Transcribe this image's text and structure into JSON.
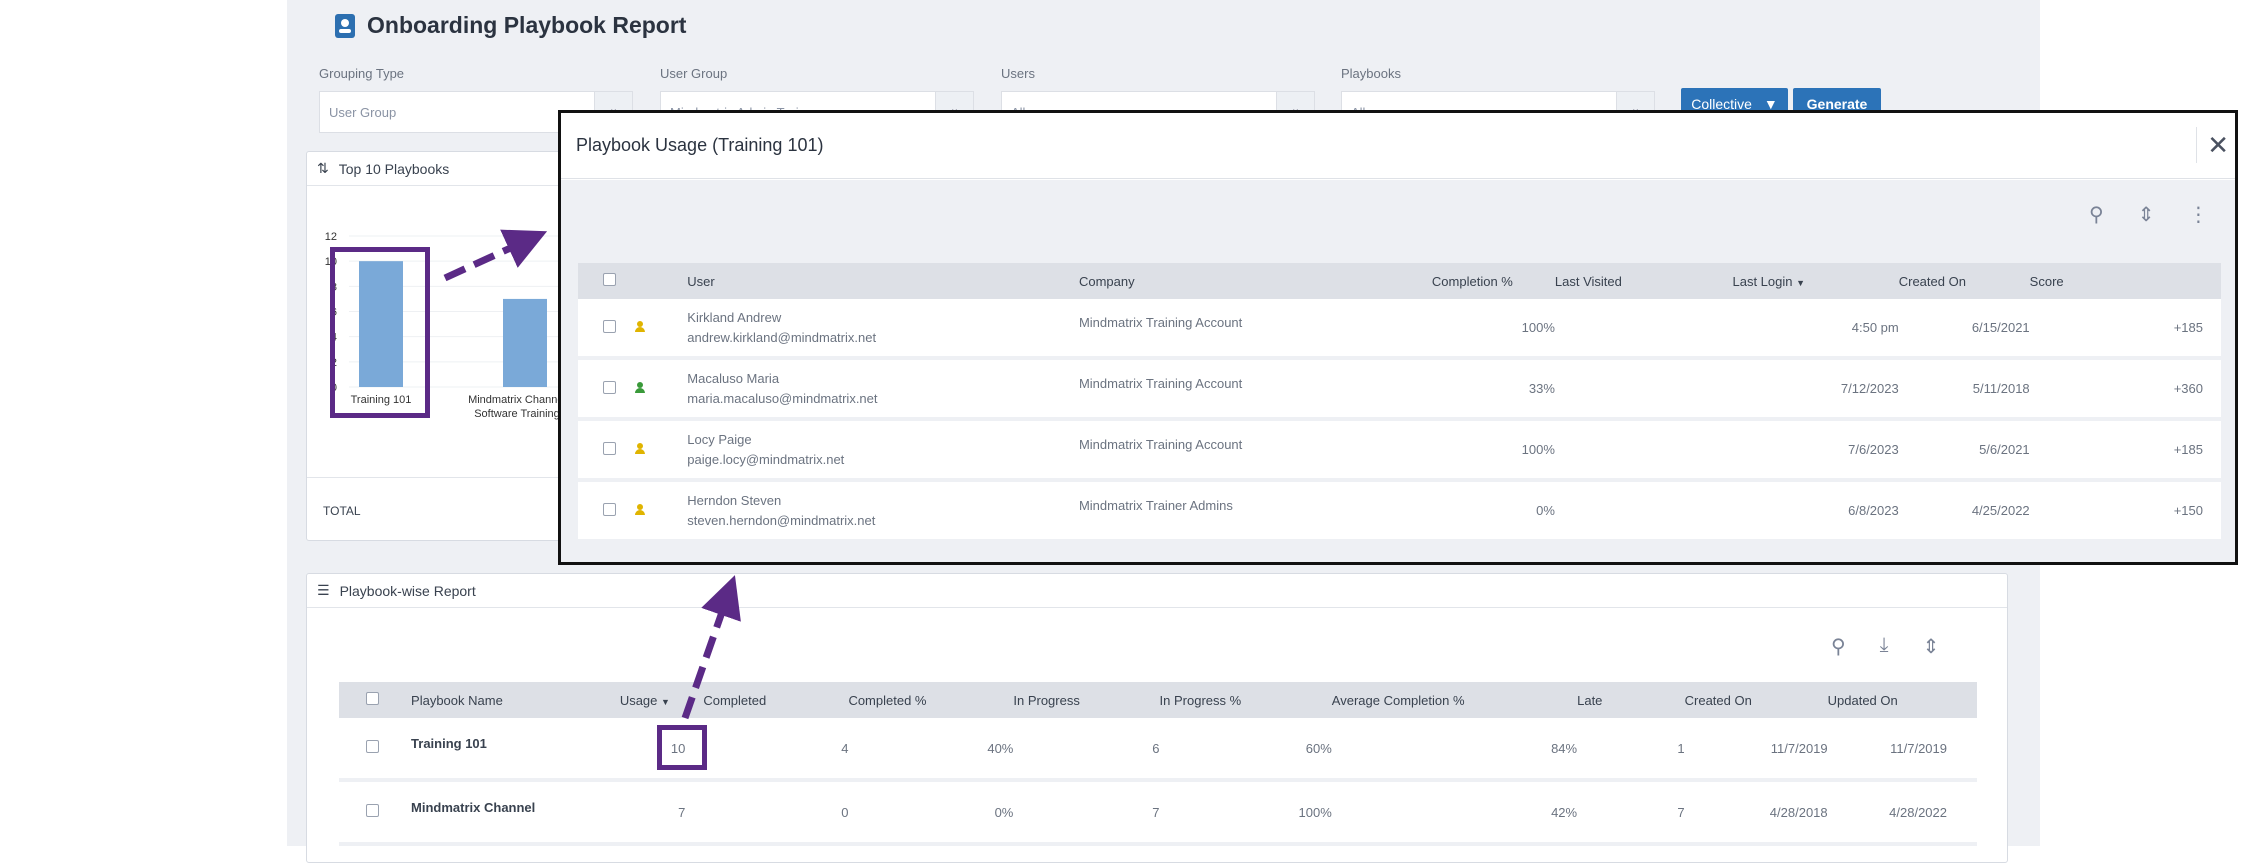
{
  "page": {
    "title": "Onboarding Playbook Report"
  },
  "filters": [
    {
      "label": "Grouping Type",
      "value": "User Group"
    },
    {
      "label": "User Group",
      "value": "Mindmatrix Admin Trainees"
    },
    {
      "label": "Users",
      "value": "All"
    },
    {
      "label": "Playbooks",
      "value": "All"
    }
  ],
  "buttons": {
    "collective": "Collective",
    "generate": "Generate"
  },
  "top_panel": {
    "title": "Top 10 Playbooks",
    "total_label": "TOTAL"
  },
  "chart_data": {
    "type": "bar",
    "categories": [
      "Training 101",
      "Mindmatrix Channel Software Training"
    ],
    "values": [
      10,
      7
    ],
    "yticks": [
      0,
      2,
      4,
      6,
      8,
      10,
      12
    ],
    "ylim": [
      0,
      12
    ],
    "color": "#7aa9d8"
  },
  "report_panel": {
    "title": "Playbook-wise Report",
    "columns": [
      "Playbook Name",
      "Usage",
      "Completed",
      "Completed %",
      "In Progress",
      "In Progress %",
      "Average Completion %",
      "Late",
      "Created On",
      "Updated On"
    ],
    "rows": [
      {
        "name": "Training 101",
        "usage": "10",
        "completed": "4",
        "completed_pct": "40%",
        "in_progress": "6",
        "in_progress_pct": "60%",
        "avg_completion": "84%",
        "late": "1",
        "created": "11/7/2019",
        "updated": "11/7/2019"
      },
      {
        "name": "Mindmatrix Channel",
        "usage": "7",
        "completed": "0",
        "completed_pct": "0%",
        "in_progress": "7",
        "in_progress_pct": "100%",
        "avg_completion": "42%",
        "late": "7",
        "created": "4/28/2018",
        "updated": "4/28/2022"
      }
    ]
  },
  "modal": {
    "title": "Playbook Usage (Training 101)",
    "columns": [
      "User",
      "Company",
      "Completion %",
      "Last Visited",
      "Last Login",
      "Created On",
      "Score"
    ],
    "rows": [
      {
        "name": "Kirkland Andrew",
        "email": "andrew.kirkland@mindmatrix.net",
        "company": "Mindmatrix Training Account",
        "completion": "100%",
        "last_visited": "",
        "last_login": "4:50 pm",
        "created": "6/15/2021",
        "score": "+185",
        "icon_color": "#e0b400"
      },
      {
        "name": "Macaluso Maria",
        "email": "maria.macaluso@mindmatrix.net",
        "company": "Mindmatrix Training Account",
        "completion": "33%",
        "last_visited": "",
        "last_login": "7/12/2023",
        "created": "5/11/2018",
        "score": "+360",
        "icon_color": "#3a9a3a"
      },
      {
        "name": "Locy Paige",
        "email": "paige.locy@mindmatrix.net",
        "company": "Mindmatrix Training Account",
        "completion": "100%",
        "last_visited": "",
        "last_login": "7/6/2023",
        "created": "5/6/2021",
        "score": "+185",
        "icon_color": "#e0b400"
      },
      {
        "name": "Herndon Steven",
        "email": "steven.herndon@mindmatrix.net",
        "company": "Mindmatrix Trainer Admins",
        "completion": "0%",
        "last_visited": "",
        "last_login": "6/8/2023",
        "created": "4/25/2022",
        "score": "+150",
        "icon_color": "#e0b400"
      }
    ]
  },
  "colors": {
    "highlight": "#5b2a86",
    "accent": "#2c73b8"
  }
}
